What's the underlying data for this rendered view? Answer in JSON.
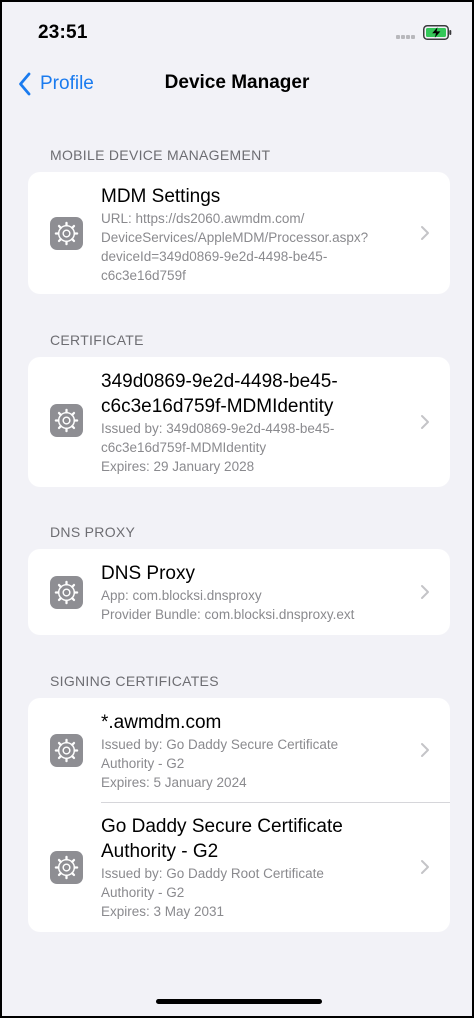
{
  "status_bar": {
    "time": "23:51",
    "battery_charging": true
  },
  "nav": {
    "back_label": "Profile",
    "title": "Device Manager"
  },
  "sections": [
    {
      "header": "MOBILE DEVICE MANAGEMENT",
      "rows": [
        {
          "title": "MDM Settings",
          "subtitles": [
            "URL: https://ds2060.awmdm.com/",
            "DeviceServices/AppleMDM/Processor.aspx?",
            "deviceId=349d0869-9e2d-4498-be45-",
            "c6c3e16d759f"
          ],
          "icon": "gear-icon"
        }
      ]
    },
    {
      "header": "CERTIFICATE",
      "rows": [
        {
          "title_lines": [
            "349d0869-9e2d-4498-be45-",
            "c6c3e16d759f-MDMIdentity"
          ],
          "subtitles": [
            "Issued by: 349d0869-9e2d-4498-be45-",
            "c6c3e16d759f-MDMIdentity",
            "Expires: 29 January 2028"
          ],
          "icon": "gear-icon"
        }
      ]
    },
    {
      "header": "DNS PROXY",
      "rows": [
        {
          "title": "DNS Proxy",
          "subtitles": [
            "App: com.blocksi.dnsproxy",
            "Provider Bundle: com.blocksi.dnsproxy.ext"
          ],
          "icon": "gear-icon"
        }
      ]
    },
    {
      "header": "SIGNING CERTIFICATES",
      "rows": [
        {
          "title": "*.awmdm.com",
          "subtitles": [
            "Issued by: Go Daddy Secure Certificate",
            "Authority - G2",
            "Expires: 5 January 2024"
          ],
          "icon": "gear-icon"
        },
        {
          "title_lines": [
            "Go Daddy Secure Certificate",
            "Authority - G2"
          ],
          "subtitles": [
            "Issued by: Go Daddy Root Certificate",
            "Authority - G2",
            "Expires: 3 May 2031"
          ],
          "icon": "gear-icon"
        }
      ]
    }
  ],
  "colors": {
    "background": "#f2f2f7",
    "accent": "#1a7bef",
    "icon_bg": "#8e8e93",
    "battery": "#34c759"
  }
}
